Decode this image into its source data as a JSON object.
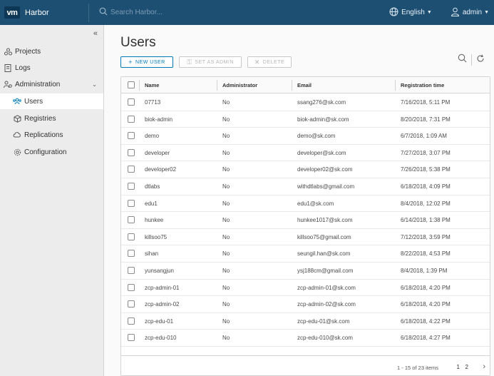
{
  "header": {
    "logo": "vm",
    "app_title": "Harbor",
    "search_placeholder": "Search Harbor...",
    "language": "English",
    "user": "admin"
  },
  "sidebar": {
    "items": [
      {
        "label": "Projects",
        "icon": "projects-icon"
      },
      {
        "label": "Logs",
        "icon": "logs-icon"
      },
      {
        "label": "Administration",
        "icon": "administration-icon"
      },
      {
        "label": "Users",
        "icon": "users-icon",
        "active": true
      },
      {
        "label": "Registries",
        "icon": "registries-icon"
      },
      {
        "label": "Replications",
        "icon": "replications-icon"
      },
      {
        "label": "Configuration",
        "icon": "configuration-icon"
      }
    ]
  },
  "main": {
    "title": "Users",
    "buttons": {
      "new_user": "NEW USER",
      "set_as_admin": "SET AS ADMIN",
      "delete": "DELETE"
    },
    "table": {
      "columns": [
        "Name",
        "Administrator",
        "Email",
        "Registration time"
      ],
      "rows": [
        [
          "07713",
          "No",
          "ssang276@sk.com",
          "7/16/2018, 5:11 PM"
        ],
        [
          "biok-admin",
          "No",
          "biok-admin@sk.com",
          "8/20/2018, 7:31 PM"
        ],
        [
          "demo",
          "No",
          "demo@sk.com",
          "6/7/2018, 1:09 AM"
        ],
        [
          "developer",
          "No",
          "developer@sk.com",
          "7/27/2018, 3:07 PM"
        ],
        [
          "developer02",
          "No",
          "developer02@sk.com",
          "7/26/2018, 5:38 PM"
        ],
        [
          "dtlabs",
          "No",
          "withdtlabs@gmail.com",
          "6/18/2018, 4:09 PM"
        ],
        [
          "edu1",
          "No",
          "edu1@sk.com",
          "8/4/2018, 12:02 PM"
        ],
        [
          "hunkee",
          "No",
          "hunkee1017@sk.com",
          "6/14/2018, 1:38 PM"
        ],
        [
          "killsoo75",
          "No",
          "killsoo75@gmail.com",
          "7/12/2018, 3:59 PM"
        ],
        [
          "sihan",
          "No",
          "seungil.han@sk.com",
          "8/22/2018, 4:53 PM"
        ],
        [
          "yunsangjun",
          "No",
          "ysj188cm@gmail.com",
          "8/4/2018, 1:39 PM"
        ],
        [
          "zcp-admin-01",
          "No",
          "zcp-admin-01@sk.com",
          "6/18/2018, 4:20 PM"
        ],
        [
          "zcp-admin-02",
          "No",
          "zcp-admin-02@sk.com",
          "6/18/2018, 4:20 PM"
        ],
        [
          "zcp-edu-01",
          "No",
          "zcp-edu-01@sk.com",
          "6/18/2018, 4:22 PM"
        ],
        [
          "zcp-edu-010",
          "No",
          "zcp-edu-010@sk.com",
          "6/18/2018, 4:27 PM"
        ]
      ]
    },
    "pagination": {
      "summary": "1 - 15 of 23 items",
      "pages": [
        "1",
        "2"
      ],
      "current": "1"
    }
  },
  "colors": {
    "header_bg": "#1d4f73",
    "accent": "#0079b8",
    "sidebar_bg": "#ececec"
  }
}
